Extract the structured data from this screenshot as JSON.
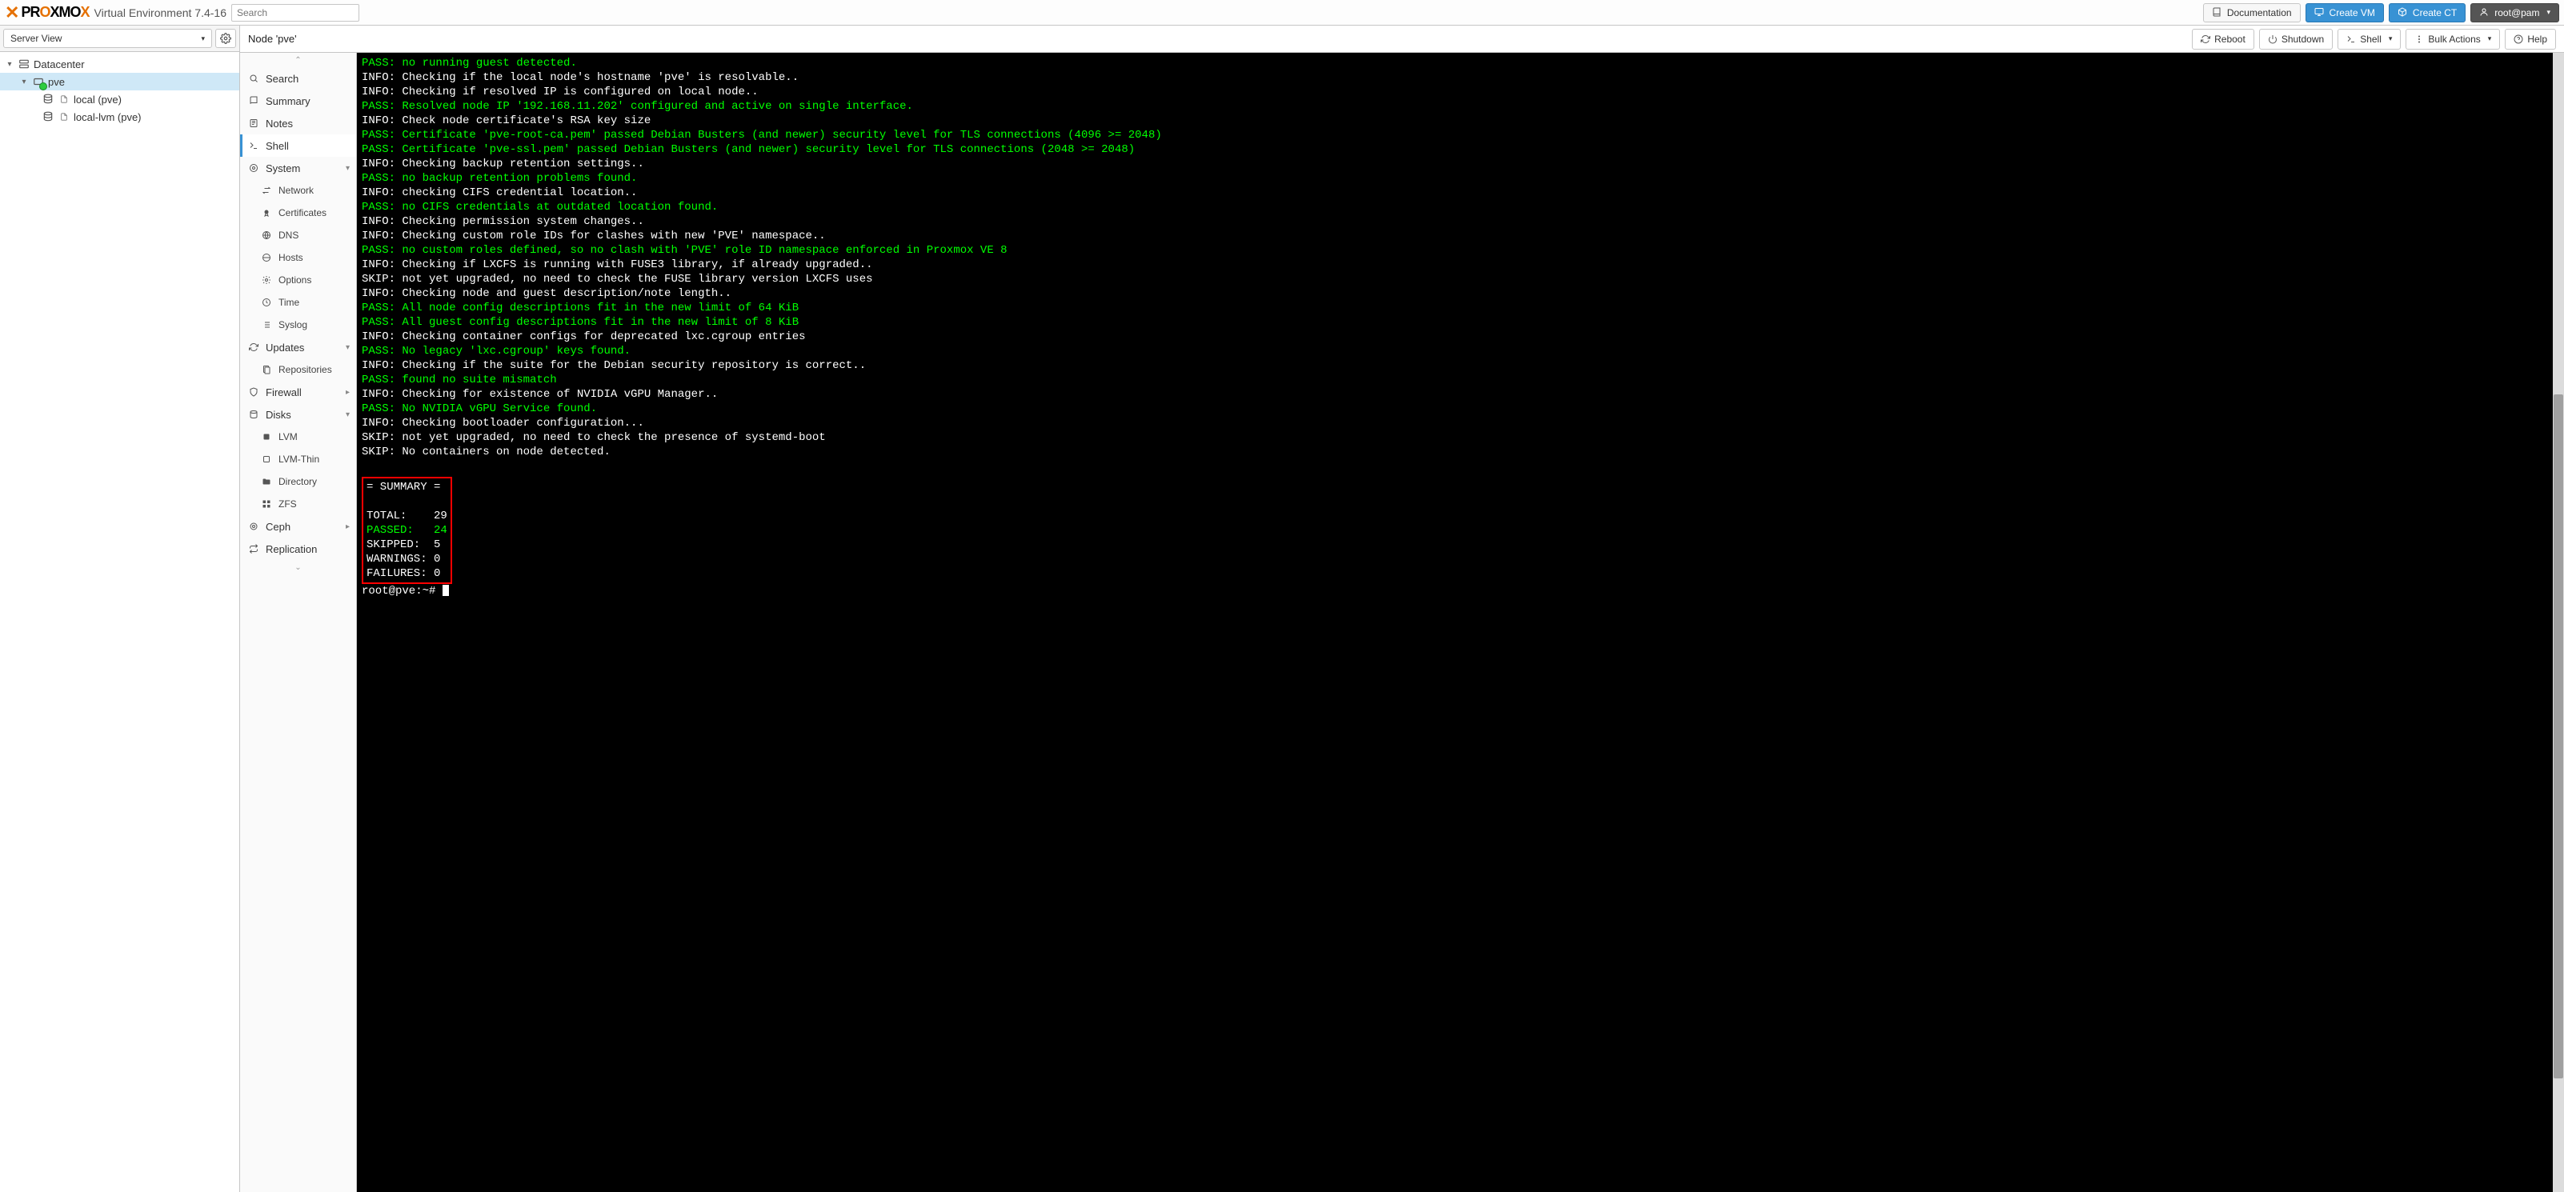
{
  "product": {
    "brand_plain": "PR",
    "brand_accent": "O",
    "brand_tail": "XMO",
    "subtitle": "Virtual Environment 7.4-16"
  },
  "search": {
    "placeholder": "Search"
  },
  "topbar": {
    "documentation": "Documentation",
    "create_vm": "Create VM",
    "create_ct": "Create CT",
    "user": "root@pam"
  },
  "leftpanel": {
    "view_label": "Server View",
    "tree": {
      "datacenter": "Datacenter",
      "node": "pve",
      "local": "local (pve)",
      "local_lvm": "local-lvm (pve)"
    }
  },
  "crumb": {
    "title": "Node 'pve'"
  },
  "actionbar": {
    "reboot": "Reboot",
    "shutdown": "Shutdown",
    "shell": "Shell",
    "bulk": "Bulk Actions",
    "help": "Help"
  },
  "nodemenu": {
    "search": "Search",
    "summary": "Summary",
    "notes": "Notes",
    "shell": "Shell",
    "system": "System",
    "network": "Network",
    "certificates": "Certificates",
    "dns": "DNS",
    "hosts": "Hosts",
    "options": "Options",
    "time": "Time",
    "syslog": "Syslog",
    "updates": "Updates",
    "repositories": "Repositories",
    "firewall": "Firewall",
    "disks": "Disks",
    "lvm": "LVM",
    "lvm_thin": "LVM-Thin",
    "directory": "Directory",
    "zfs": "ZFS",
    "ceph": "Ceph",
    "replication": "Replication"
  },
  "terminal": {
    "lines": [
      {
        "cls": "g",
        "text": "PASS: no running guest detected."
      },
      {
        "cls": "w",
        "text": "INFO: Checking if the local node's hostname 'pve' is resolvable.."
      },
      {
        "cls": "w",
        "text": "INFO: Checking if resolved IP is configured on local node.."
      },
      {
        "cls": "g",
        "text": "PASS: Resolved node IP '192.168.11.202' configured and active on single interface."
      },
      {
        "cls": "w",
        "text": "INFO: Check node certificate's RSA key size"
      },
      {
        "cls": "g",
        "text": "PASS: Certificate 'pve-root-ca.pem' passed Debian Busters (and newer) security level for TLS connections (4096 >= 2048)"
      },
      {
        "cls": "g",
        "text": "PASS: Certificate 'pve-ssl.pem' passed Debian Busters (and newer) security level for TLS connections (2048 >= 2048)"
      },
      {
        "cls": "w",
        "text": "INFO: Checking backup retention settings.."
      },
      {
        "cls": "g",
        "text": "PASS: no backup retention problems found."
      },
      {
        "cls": "w",
        "text": "INFO: checking CIFS credential location.."
      },
      {
        "cls": "g",
        "text": "PASS: no CIFS credentials at outdated location found."
      },
      {
        "cls": "w",
        "text": "INFO: Checking permission system changes.."
      },
      {
        "cls": "w",
        "text": "INFO: Checking custom role IDs for clashes with new 'PVE' namespace.."
      },
      {
        "cls": "g",
        "text": "PASS: no custom roles defined, so no clash with 'PVE' role ID namespace enforced in Proxmox VE 8"
      },
      {
        "cls": "w",
        "text": "INFO: Checking if LXCFS is running with FUSE3 library, if already upgraded.."
      },
      {
        "cls": "w",
        "text": "SKIP: not yet upgraded, no need to check the FUSE library version LXCFS uses"
      },
      {
        "cls": "w",
        "text": "INFO: Checking node and guest description/note length.."
      },
      {
        "cls": "g",
        "text": "PASS: All node config descriptions fit in the new limit of 64 KiB"
      },
      {
        "cls": "g",
        "text": "PASS: All guest config descriptions fit in the new limit of 8 KiB"
      },
      {
        "cls": "w",
        "text": "INFO: Checking container configs for deprecated lxc.cgroup entries"
      },
      {
        "cls": "g",
        "text": "PASS: No legacy 'lxc.cgroup' keys found."
      },
      {
        "cls": "w",
        "text": "INFO: Checking if the suite for the Debian security repository is correct.."
      },
      {
        "cls": "g",
        "text": "PASS: found no suite mismatch"
      },
      {
        "cls": "w",
        "text": "INFO: Checking for existence of NVIDIA vGPU Manager.."
      },
      {
        "cls": "g",
        "text": "PASS: No NVIDIA vGPU Service found."
      },
      {
        "cls": "w",
        "text": "INFO: Checking bootloader configuration..."
      },
      {
        "cls": "w",
        "text": "SKIP: not yet upgraded, no need to check the presence of systemd-boot"
      },
      {
        "cls": "w",
        "text": "SKIP: No containers on node detected."
      }
    ],
    "summary": {
      "header": "= SUMMARY =",
      "total_label": "TOTAL:    ",
      "total": "29",
      "passed_label": "PASSED:   ",
      "passed": "24",
      "skipped_label": "SKIPPED:  ",
      "skipped": "5",
      "warnings_label": "WARNINGS: ",
      "warnings": "0",
      "failures_label": "FAILURES: ",
      "failures": "0"
    },
    "prompt": "root@pve:~# "
  }
}
